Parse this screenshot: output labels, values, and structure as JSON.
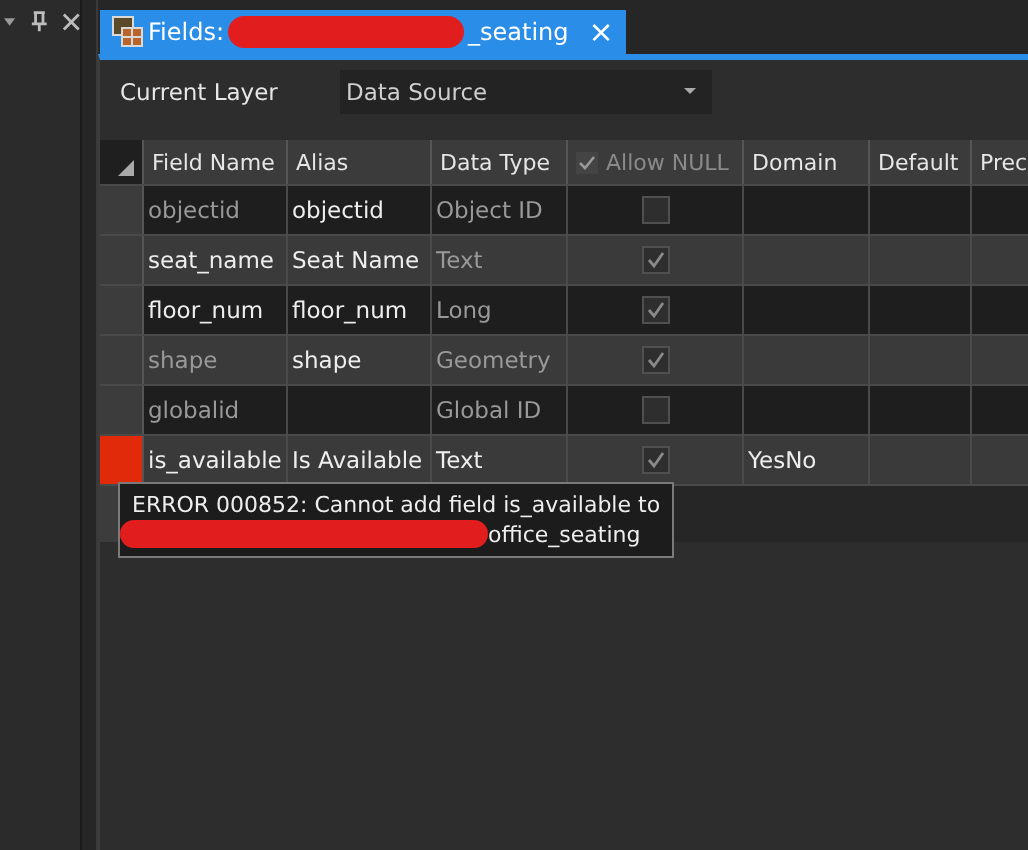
{
  "tab": {
    "title_prefix": "Fields:",
    "title_suffix": "_seating",
    "close": "×",
    "selected": true
  },
  "current_layer": {
    "label": "Current Layer",
    "value": "Data Source"
  },
  "table": {
    "columns": [
      "Field Name",
      "Alias",
      "Data Type",
      "Allow NULL",
      "Domain",
      "Default",
      "Prec"
    ],
    "rows": [
      {
        "field_name": "objectid",
        "alias": "objectid",
        "data_type": "Object ID",
        "allow_null": false,
        "domain": "",
        "system": true,
        "error": false
      },
      {
        "field_name": "seat_name",
        "alias": "Seat Name",
        "data_type": "Text",
        "allow_null": true,
        "domain": "",
        "system": false,
        "error": false
      },
      {
        "field_name": "floor_num",
        "alias": "floor_num",
        "data_type": "Long",
        "allow_null": true,
        "domain": "",
        "system": false,
        "error": false
      },
      {
        "field_name": "shape",
        "alias": "shape",
        "data_type": "Geometry",
        "allow_null": true,
        "domain": "",
        "system": true,
        "error": false
      },
      {
        "field_name": "globalid",
        "alias": "",
        "data_type": "Global ID",
        "allow_null": false,
        "domain": "",
        "system": true,
        "error": false
      },
      {
        "field_name": "is_available",
        "alias": "Is Available",
        "data_type": "Text",
        "allow_null": true,
        "domain": "YesNo",
        "system": false,
        "error": true
      }
    ]
  },
  "tooltip": {
    "line_1": "ERROR 000852: Cannot add field is_available to",
    "line_2_suffix": "office_seating"
  }
}
